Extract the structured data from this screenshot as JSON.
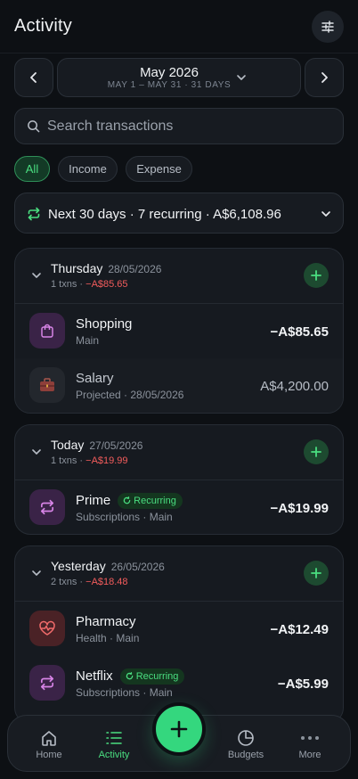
{
  "header": {
    "title": "Activity",
    "filter_icon": "sliders-icon"
  },
  "month": {
    "name": "May 2026",
    "range": "MAY 1 – MAY 31 · 31 DAYS",
    "prev_icon": "chevron-left-icon",
    "next_icon": "chevron-right-icon"
  },
  "search": {
    "placeholder": "Search transactions",
    "value": ""
  },
  "filters": {
    "all": "All",
    "income": "Income",
    "expense": "Expense",
    "selected": "All"
  },
  "recurring": {
    "text": "Next 30 days · 7 recurring · A$6,108.96"
  },
  "groups": [
    {
      "day": "Thursday",
      "date": "28/05/2026",
      "count": "1 txns",
      "total": "−A$85.65",
      "rows": [
        {
          "title": "Shopping",
          "subtitle": "Main",
          "amount": "−A$85.65",
          "icon": "shopping-bag-icon"
        },
        {
          "title": "Salary",
          "subtitle": "Projected · 28/05/2026",
          "amount": "A$4,200.00",
          "icon": "briefcase-icon"
        }
      ]
    },
    {
      "day": "Today",
      "date": "27/05/2026",
      "count": "1 txns",
      "total": "−A$19.99",
      "rows": [
        {
          "title": "Prime",
          "badge": "Recurring",
          "subtitle": "Subscriptions · Main",
          "amount": "−A$19.99",
          "icon": "repeat-icon"
        }
      ]
    },
    {
      "day": "Yesterday",
      "date": "26/05/2026",
      "count": "2 txns",
      "total": "−A$18.48",
      "rows": [
        {
          "title": "Pharmacy",
          "subtitle": "Health · Main",
          "amount": "−A$12.49",
          "icon": "heart-pulse-icon"
        },
        {
          "title": "Netflix",
          "badge": "Recurring",
          "subtitle": "Subscriptions · Main",
          "amount": "−A$5.99",
          "icon": "repeat-icon"
        }
      ]
    }
  ],
  "tabs": {
    "home": "Home",
    "activity": "Activity",
    "budgets": "Budgets",
    "more": "More",
    "selected": "Activity"
  },
  "colors": {
    "accent": "#34d77e",
    "negative": "#f25c5c",
    "background": "#0d1014",
    "card": "#161a20",
    "shopping_tint": "#3a2347",
    "pharmacy_tint": "#4a2226",
    "subscription_tint": "#3a2347"
  }
}
